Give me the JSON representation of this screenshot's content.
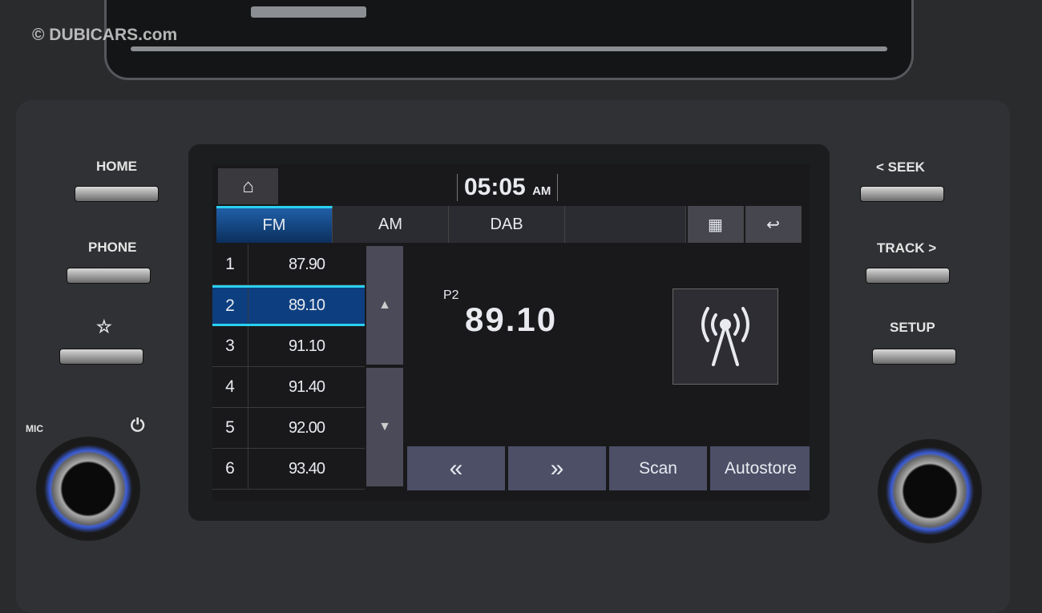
{
  "watermark": "© DUBICARS.com",
  "hardware": {
    "home": "HOME",
    "phone": "PHONE",
    "seek": "< SEEK",
    "track": "TRACK >",
    "setup": "SETUP",
    "mic": "MIC",
    "star": "☆",
    "power": "⏻"
  },
  "screen": {
    "clock": {
      "time": "05:05",
      "ampm": "AM"
    },
    "home_icon": "⌂",
    "tabs": [
      {
        "label": "FM",
        "active": true
      },
      {
        "label": "AM"
      },
      {
        "label": "DAB"
      }
    ],
    "grid_icon": "▦",
    "back_icon": "↩",
    "presets": [
      {
        "n": "1",
        "f": "87.90"
      },
      {
        "n": "2",
        "f": "89.10",
        "selected": true
      },
      {
        "n": "3",
        "f": "91.10"
      },
      {
        "n": "4",
        "f": "91.40"
      },
      {
        "n": "5",
        "f": "92.00"
      },
      {
        "n": "6",
        "f": "93.40"
      }
    ],
    "scroll": {
      "up": "▲",
      "down": "▼"
    },
    "preset_label": "P2",
    "frequency": "89.10",
    "controls": [
      "«",
      "»",
      "Scan",
      "Autostore"
    ],
    "accent": "#2ad0f0"
  }
}
